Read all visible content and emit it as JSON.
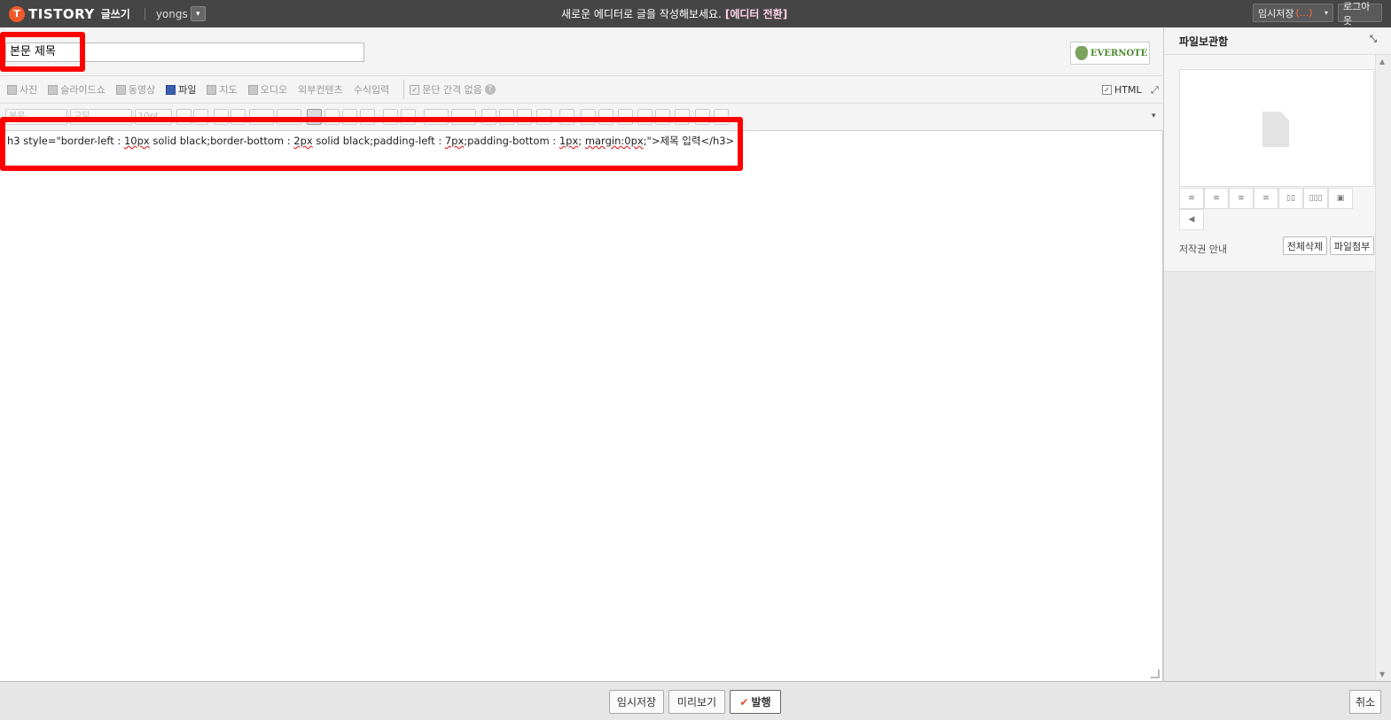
{
  "topbar": {
    "logo_text": "TISTORY",
    "app_label": "글쓰기",
    "blog_name": "yongs",
    "notice": "새로운 에디터로 글을 작성해보세요.",
    "notice_link": "[에디터 전환]",
    "draft_label": "임시저장",
    "draft_count": "(...)",
    "logout_label": "로그아웃"
  },
  "title": {
    "value": "본문 제목",
    "evernote_label": "EVERNOTE"
  },
  "insert_toolbar": {
    "items": [
      {
        "label": "사진",
        "icon": "photo-icon"
      },
      {
        "label": "슬라이드쇼",
        "icon": "slideshow-icon"
      },
      {
        "label": "동영상",
        "icon": "video-icon"
      },
      {
        "label": "파일",
        "icon": "file-icon"
      },
      {
        "label": "지도",
        "icon": "map-icon"
      },
      {
        "label": "오디오",
        "icon": "audio-icon"
      },
      {
        "label": "외부컨텐츠",
        "icon": ""
      },
      {
        "label": "수식입력",
        "icon": ""
      }
    ],
    "no_spacing_label": "문단 간격 없음",
    "html_label": "HTML"
  },
  "format_toolbar": {
    "style": "본문",
    "font": "고딕",
    "size": "10pt"
  },
  "editor": {
    "code_parts": [
      "h3 style=\"border-left : ",
      "10px",
      " solid black;border-bottom : ",
      "2px",
      " solid black;padding-left : ",
      "7px",
      ";padding-bottom : ",
      "1px",
      "; ",
      "margin:0px",
      ";\">제목 입력</h3>"
    ]
  },
  "sidebar": {
    "title": "파일보관함",
    "copyright_label": "저작권 안내",
    "delete_all_label": "전체삭제",
    "attach_label": "파일첨부"
  },
  "footer": {
    "save_label": "임시저장",
    "preview_label": "미리보기",
    "publish_label": "발행",
    "cancel_label": "취소"
  },
  "colors": {
    "topbar_bg": "#454545",
    "logo_accent": "#ef5a2a",
    "highlight": "#ff0000",
    "publish_check": "#e2502c"
  }
}
